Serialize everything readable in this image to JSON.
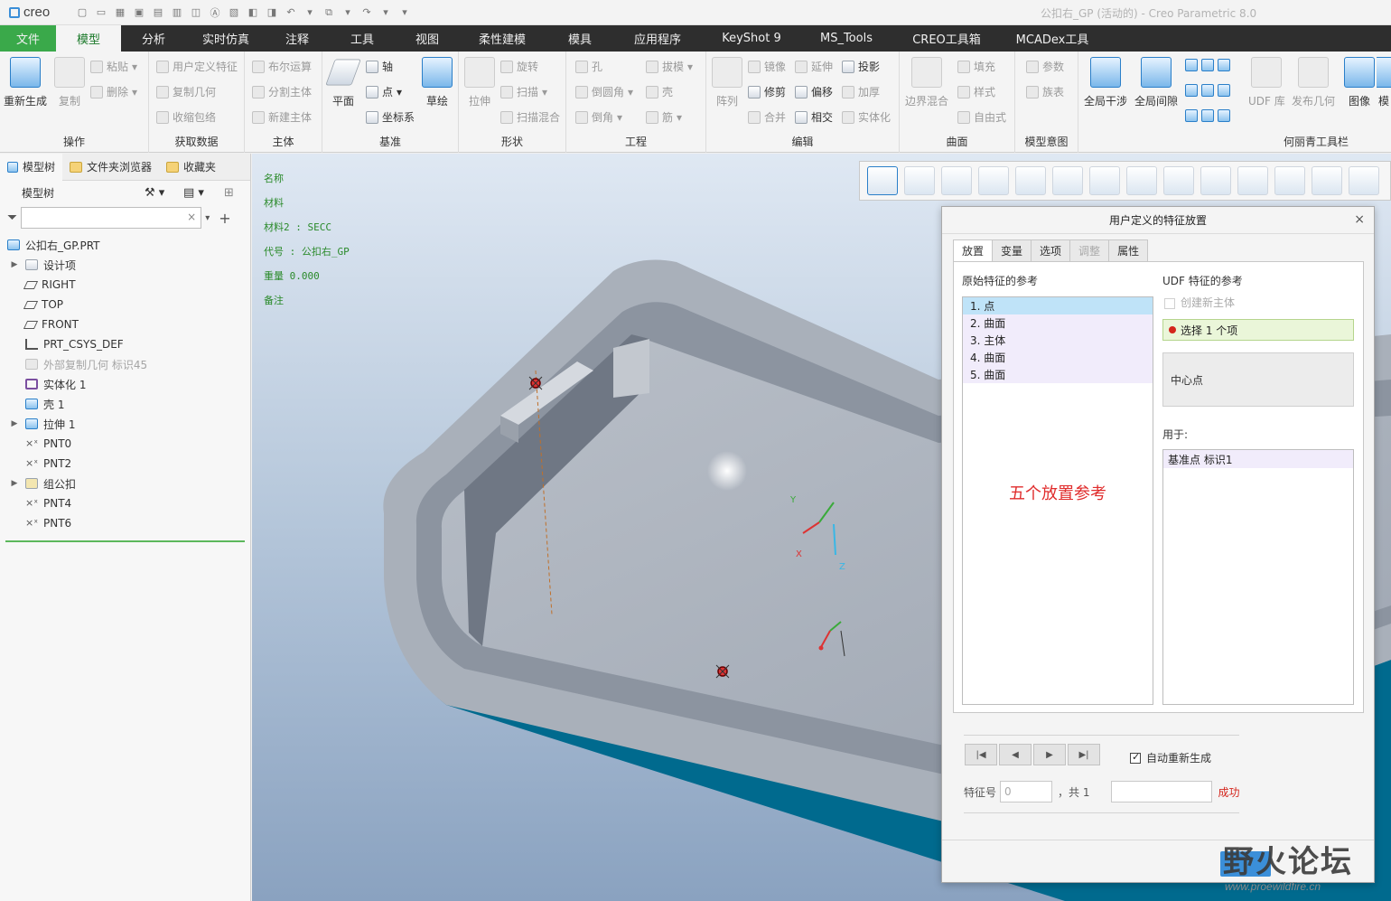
{
  "app": {
    "logo_text": "creo",
    "title": "公扣右_GP (活动的) - Creo Parametric 8.0"
  },
  "tabs": [
    {
      "label": "文件"
    },
    {
      "label": "模型"
    },
    {
      "label": "分析"
    },
    {
      "label": "实时仿真"
    },
    {
      "label": "注释"
    },
    {
      "label": "工具"
    },
    {
      "label": "视图"
    },
    {
      "label": "柔性建模"
    },
    {
      "label": "模具"
    },
    {
      "label": "应用程序"
    },
    {
      "label": "KeyShot 9"
    },
    {
      "label": "MS_Tools"
    },
    {
      "label": "CREO工具箱"
    },
    {
      "label": "MCADex工具"
    }
  ],
  "ribbon": {
    "ops": {
      "label": "操作",
      "regen": "重新生成",
      "copy": "复制",
      "paste": "粘贴",
      "delete": "删除"
    },
    "getdata": {
      "label": "获取数据",
      "udf": "用户定义特征",
      "copygeom": "复制几何",
      "shrink": "收缩包络"
    },
    "body": {
      "label": "主体",
      "boolean": "布尔运算",
      "split": "分割主体",
      "newbody": "新建主体"
    },
    "datum": {
      "label": "基准",
      "plane": "平面",
      "axis": "轴",
      "point": "点",
      "csys": "坐标系",
      "sketch": "草绘"
    },
    "shape": {
      "label": "形状",
      "extrude": "拉伸",
      "revolve": "旋转",
      "sweep": "扫描",
      "sweepblend": "扫描混合"
    },
    "eng": {
      "label": "工程",
      "hole": "孔",
      "round": "倒圆角",
      "chamfer": "倒角",
      "draft": "拔模",
      "shell": "壳",
      "rib": "筋"
    },
    "edit": {
      "label": "编辑",
      "pattern": "阵列",
      "mirror": "镜像",
      "extend": "延伸",
      "project": "投影",
      "trim": "修剪",
      "offset": "偏移",
      "thicken": "加厚",
      "merge": "合并",
      "intersect": "相交",
      "solidify": "实体化"
    },
    "surface": {
      "label": "曲面",
      "boundary": "边界混合",
      "fill": "填充",
      "style": "样式",
      "freestyle": "自由式"
    },
    "intent": {
      "label": "模型意图",
      "param": "参数",
      "family": "族表"
    },
    "custom": {
      "label": "何丽青工具栏",
      "interference": "全局干涉",
      "clearance": "全局间隙",
      "udflib": "UDF 库",
      "publish": "发布几何",
      "image": "图像",
      "more": "模"
    }
  },
  "left_panel": {
    "tabs": [
      "模型树",
      "文件夹浏览器",
      "收藏夹"
    ],
    "tree_title": "模型树",
    "filter_placeholder": "",
    "root": "公扣右_GP.PRT",
    "nodes": [
      "设计项",
      "RIGHT",
      "TOP",
      "FRONT",
      "PRT_CSYS_DEF",
      "外部复制几何 标识45",
      "实体化 1",
      "壳 1",
      "拉伸 1",
      "PNT0",
      "PNT2",
      "组公扣",
      "PNT4",
      "PNT6"
    ]
  },
  "viewport_info": [
    "名称",
    "材料",
    "材料2 : SECC",
    "代号 : 公扣右_GP",
    "重量 0.000",
    "备注"
  ],
  "dialog": {
    "title": "用户定义的特征放置",
    "close": "×",
    "tabs": [
      "放置",
      "变量",
      "选项",
      "调整",
      "属性"
    ],
    "orig_refs_label": "原始特征的参考",
    "orig_refs": [
      "1. 点",
      "2. 曲面",
      "3. 主体",
      "4. 曲面",
      "5. 曲面"
    ],
    "udf_refs_label": "UDF 特征的参考",
    "create_body_label": "创建新主体",
    "select_text": "选择 1 个项",
    "center_text": "中心点",
    "used_label": "用于:",
    "used_items": [
      "基准点 标识1"
    ],
    "auto_regen": "自动重新生成",
    "feat_no_label": "特征号",
    "feat_no_value": "0",
    "feat_total": "，共 1",
    "status": "成功"
  },
  "annotation": "五个放置参考",
  "watermark": {
    "text": "野火论坛",
    "sub": "www.proewildfire.cn"
  }
}
